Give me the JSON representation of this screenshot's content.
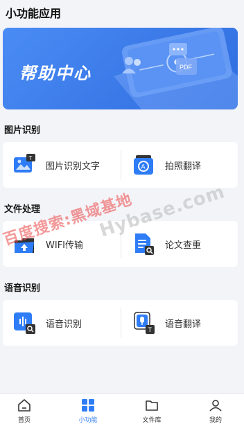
{
  "page": {
    "title": "小功能应用"
  },
  "banner": {
    "title": "帮助中心"
  },
  "sections": [
    {
      "title": "图片识别",
      "items": [
        {
          "label": "图片识别文字",
          "icon": "image-text-recognition-icon"
        },
        {
          "label": "拍照翻译",
          "icon": "photo-translate-icon"
        }
      ]
    },
    {
      "title": "文件处理",
      "items": [
        {
          "label": "WIFI传输",
          "icon": "wifi-transfer-icon"
        },
        {
          "label": "论文查重",
          "icon": "paper-check-icon"
        }
      ]
    },
    {
      "title": "语音识别",
      "items": [
        {
          "label": "语音识别",
          "icon": "voice-recognition-icon"
        },
        {
          "label": "语音翻译",
          "icon": "voice-translate-icon"
        }
      ]
    }
  ],
  "watermark": {
    "red": "百度搜索:黑域基地",
    "gray": "Hybase.com"
  },
  "tabbar": {
    "tabs": [
      {
        "label": "首页",
        "icon": "home-icon"
      },
      {
        "label": "小功能",
        "icon": "apps-grid-icon",
        "active": true
      },
      {
        "label": "文件库",
        "icon": "folder-icon"
      },
      {
        "label": "我的",
        "icon": "user-icon"
      }
    ]
  },
  "colors": {
    "accent": "#2e7cf6",
    "banner": "#3b7ae8",
    "background": "#f3f4f8"
  }
}
